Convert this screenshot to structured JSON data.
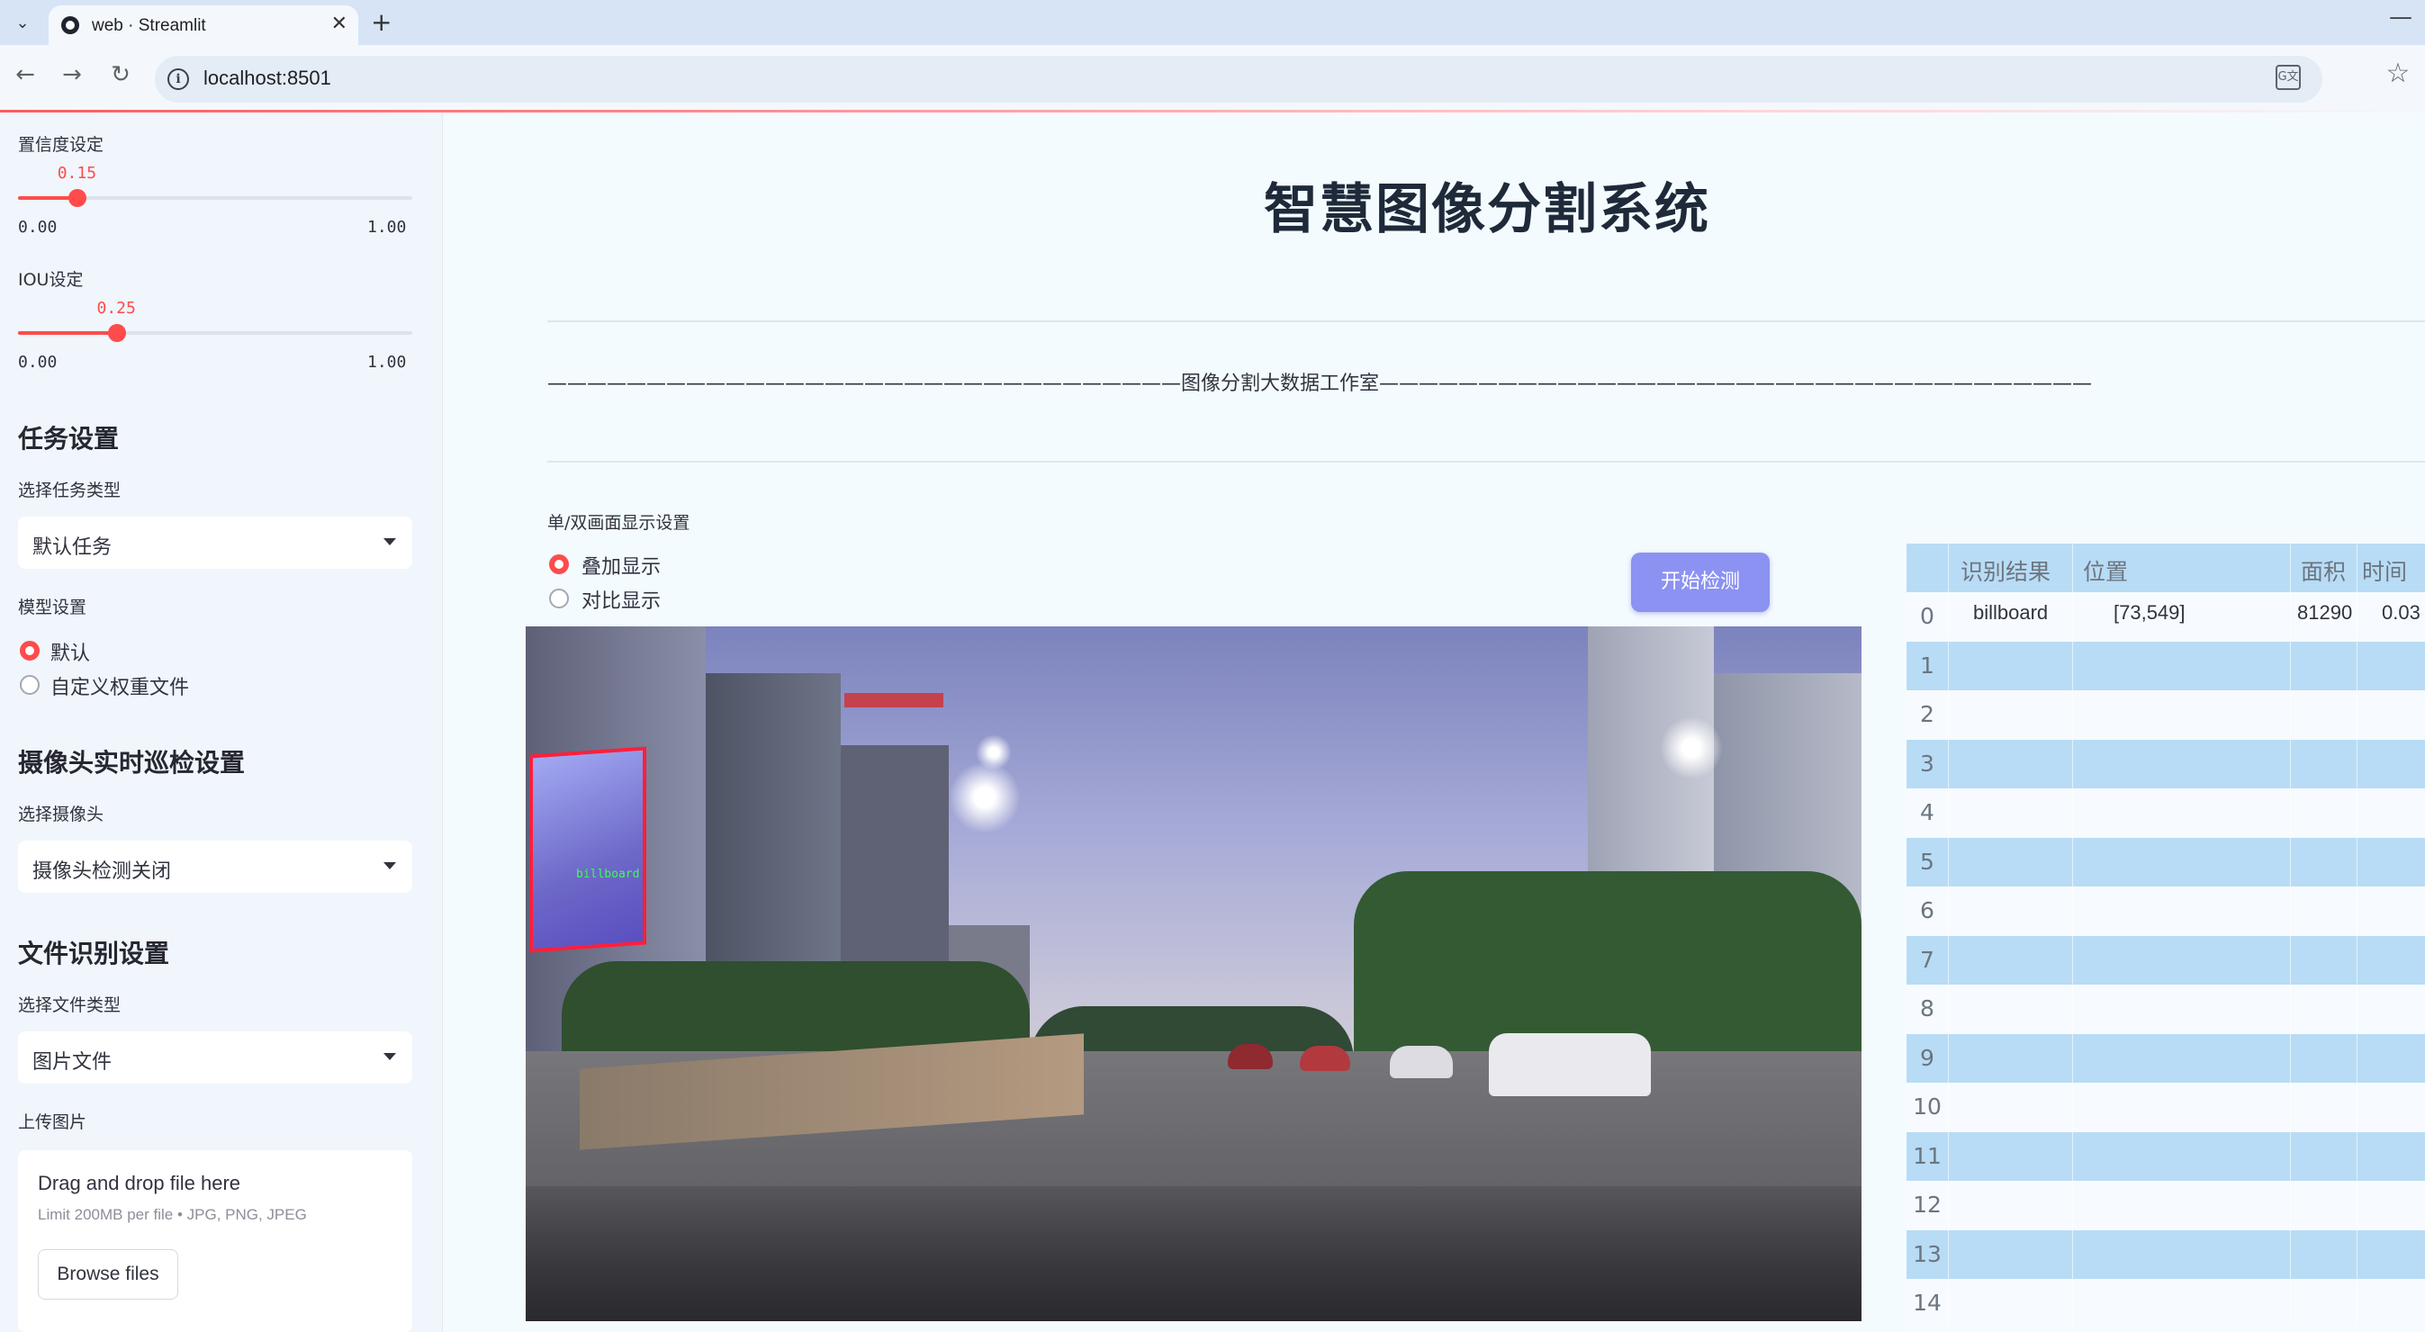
{
  "browser": {
    "tab_title": "web · Streamlit",
    "url": "localhost:8501",
    "translate_glyph": "G文",
    "icons": [
      "tab-search-icon",
      "close-icon",
      "plus-icon",
      "minimize-icon",
      "back-icon",
      "forward-icon",
      "reload-icon",
      "info-icon",
      "translate-icon",
      "star-icon"
    ]
  },
  "sidebar": {
    "confidence": {
      "label": "置信度设定",
      "value": "0.15",
      "min": "0.00",
      "max": "1.00",
      "fraction": 0.15
    },
    "iou": {
      "label": "IOU设定",
      "value": "0.25",
      "min": "0.00",
      "max": "1.00",
      "fraction": 0.25
    },
    "task_section": {
      "heading": "任务设置",
      "select_label": "选择任务类型",
      "selected": "默认任务"
    },
    "model_section": {
      "label": "模型设置",
      "options": [
        "默认",
        "自定义权重文件"
      ],
      "selected_index": 0
    },
    "camera_section": {
      "heading": "摄像头实时巡检设置",
      "select_label": "选择摄像头",
      "selected": "摄像头检测关闭"
    },
    "file_section": {
      "heading": "文件识别设置",
      "select_label": "选择文件类型",
      "selected": "图片文件"
    },
    "upload": {
      "label": "上传图片",
      "drag_text": "Drag and drop file here",
      "limit_text": "Limit 200MB per file • JPG, PNG, JPEG",
      "browse_label": "Browse files"
    }
  },
  "main": {
    "title": "智慧图像分割系统",
    "studio_line": "————————————————————————————————图像分割大数据工作室————————————————————————————————————",
    "display_mode": {
      "label": "单/双画面显示设置",
      "options": [
        "叠加显示",
        "对比显示"
      ],
      "selected_index": 0
    },
    "start_button": "开始检测",
    "detection_label": "billboard",
    "accent_color": "#ff4b4b",
    "button_color": "#8c92f2"
  },
  "results_table": {
    "columns": [
      "识别结果",
      "位置",
      "面积",
      "时间"
    ],
    "rows": [
      {
        "index": "0",
        "result": "billboard",
        "position": "[73,549]",
        "area": "81290",
        "time": "0.03"
      },
      {
        "index": "1",
        "result": "",
        "position": "",
        "area": "",
        "time": ""
      },
      {
        "index": "2",
        "result": "",
        "position": "",
        "area": "",
        "time": ""
      },
      {
        "index": "3",
        "result": "",
        "position": "",
        "area": "",
        "time": ""
      },
      {
        "index": "4",
        "result": "",
        "position": "",
        "area": "",
        "time": ""
      },
      {
        "index": "5",
        "result": "",
        "position": "",
        "area": "",
        "time": ""
      },
      {
        "index": "6",
        "result": "",
        "position": "",
        "area": "",
        "time": ""
      },
      {
        "index": "7",
        "result": "",
        "position": "",
        "area": "",
        "time": ""
      },
      {
        "index": "8",
        "result": "",
        "position": "",
        "area": "",
        "time": ""
      },
      {
        "index": "9",
        "result": "",
        "position": "",
        "area": "",
        "time": ""
      },
      {
        "index": "10",
        "result": "",
        "position": "",
        "area": "",
        "time": ""
      },
      {
        "index": "11",
        "result": "",
        "position": "",
        "area": "",
        "time": ""
      },
      {
        "index": "12",
        "result": "",
        "position": "",
        "area": "",
        "time": ""
      },
      {
        "index": "13",
        "result": "",
        "position": "",
        "area": "",
        "time": ""
      },
      {
        "index": "14",
        "result": "",
        "position": "",
        "area": "",
        "time": ""
      }
    ]
  }
}
